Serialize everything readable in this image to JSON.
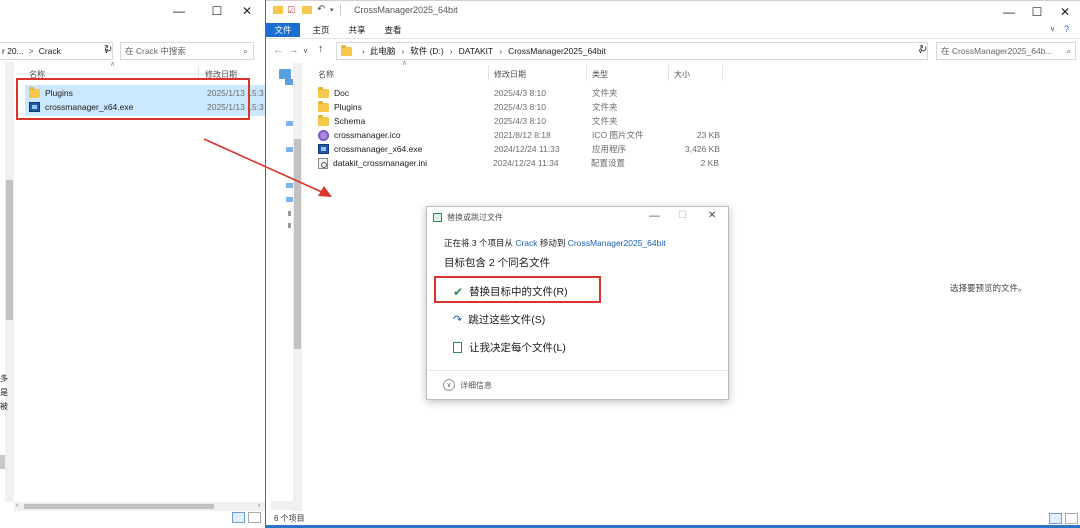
{
  "left_window": {
    "title_controls": [
      "—",
      "☐",
      "✕"
    ],
    "address_prefix": "r 20...",
    "address_separator": ">",
    "address_folder": "Crack",
    "search_placeholder": "在 Crack 中搜索",
    "col_name": "名称",
    "col_modified": "修改日期",
    "files": [
      {
        "name": "Plugins",
        "date": "2025/1/13 15:3",
        "type": "folder"
      },
      {
        "name": "crossmanager_x64.exe",
        "date": "2025/1/13 15:3",
        "type": "exe"
      }
    ],
    "left_edge_chars": [
      "多",
      "是",
      "被"
    ]
  },
  "right_window": {
    "title": "CrossManager2025_64bit",
    "title_controls": [
      "—",
      "☐",
      "✕"
    ],
    "ribbon_tabs": [
      "文件",
      "主页",
      "共享",
      "查看"
    ],
    "breadcrumb": [
      "此电脑",
      "软件 (D:)",
      "DATAKIT",
      "CrossManager2025_64bit"
    ],
    "search_placeholder": "在 CrossManager2025_64b...",
    "columns": {
      "name": "名称",
      "modified": "修改日期",
      "type": "类型",
      "size": "大小"
    },
    "files": [
      {
        "name": "Doc",
        "date": "2025/4/3 8:10",
        "type": "文件夹",
        "size": "",
        "icon": "folder"
      },
      {
        "name": "Plugins",
        "date": "2025/4/3 8:10",
        "type": "文件夹",
        "size": "",
        "icon": "folder"
      },
      {
        "name": "Schema",
        "date": "2025/4/3 8:10",
        "type": "文件夹",
        "size": "",
        "icon": "folder"
      },
      {
        "name": "crossmanager.ico",
        "date": "2021/8/12 8:18",
        "type": "ICO 图片文件",
        "size": "23 KB",
        "icon": "ico"
      },
      {
        "name": "crossmanager_x64.exe",
        "date": "2024/12/24 11:33",
        "type": "应用程序",
        "size": "3,426 KB",
        "icon": "exe"
      },
      {
        "name": "datakit_crossmanager.ini",
        "date": "2024/12/24 11:34",
        "type": "配置设置",
        "size": "2 KB",
        "icon": "ini"
      }
    ],
    "preview_text": "选择要预览的文件。",
    "status_count": "6 个项目"
  },
  "dialog": {
    "title": "替换或跳过文件",
    "info_prefix": "正在将 3 个项目从 ",
    "info_source": "Crack",
    "info_mid": " 移动到 ",
    "info_dest": "CrossManager2025_64bit",
    "heading": "目标包含 2 个同名文件",
    "option_replace": "替换目标中的文件(R)",
    "option_skip": "跳过这些文件(S)",
    "option_decide": "让我决定每个文件(L)",
    "details": "详细信息"
  },
  "colors": {
    "accent": "#0078d7",
    "annotation": "#d9352b",
    "selection": "#cce8ff"
  }
}
